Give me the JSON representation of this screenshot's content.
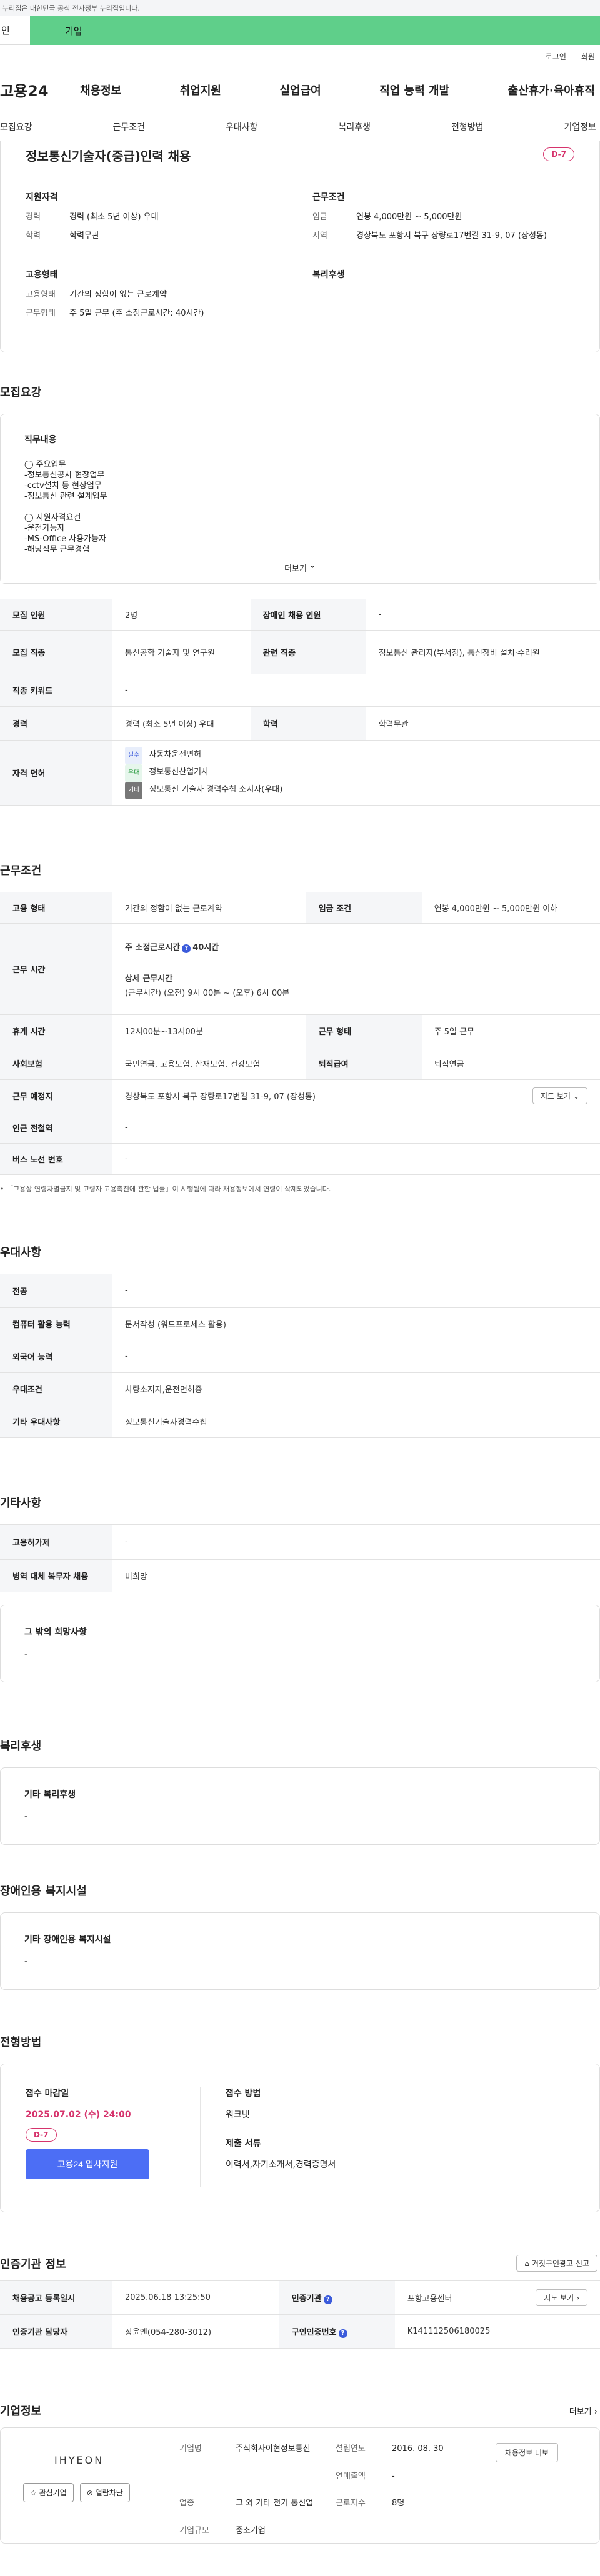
{
  "gov_banner": "누리집은 대한민국 공식 전자정부 누리집입니다.",
  "user_tabs": [
    "인",
    "기업"
  ],
  "util_links": [
    "로그인",
    "회원"
  ],
  "logo": "고용24",
  "gnb": [
    "채용정보",
    "취업지원",
    "실업급여",
    "직업 능력 개발",
    "출산휴가·육아휴직"
  ],
  "subnav": [
    "모집요강",
    "근무조건",
    "우대사항",
    "복리후생",
    "전형방법",
    "기업정보"
  ],
  "summary": {
    "title": "정보통신기술자(중급)인력 채용",
    "dday": "D-7",
    "qual_title": "지원자격",
    "qual": [
      {
        "k": "경력",
        "v": "경력 (최소 5년 이상) 우대"
      },
      {
        "k": "학력",
        "v": "학력무관"
      }
    ],
    "cond_title": "근무조건",
    "cond": [
      {
        "k": "임금",
        "v": "연봉 4,000만원 ~ 5,000만원"
      },
      {
        "k": "지역",
        "v": "경상북도 포항시 북구 장량로17번길 31-9, 07 (장성동)"
      }
    ],
    "emp_title": "고용형태",
    "emp": [
      {
        "k": "고용형태",
        "v": "기간의 정함이 없는 근로계약"
      },
      {
        "k": "근무형태",
        "v": "주 5일 근무 (주 소정근로시간: 40시간)"
      }
    ],
    "welfare_title": "복리후생"
  },
  "recruit": {
    "section_title": "모집요강",
    "duty_title": "직무내용",
    "duty_text": "◯ 주요업무\n-정보통신공사 현장업무\n-cctv설치 등 현장업무\n-정보통신 관련 설계업무\n\n◯ 지원자격요건\n-운전가능자\n-MS-Office 사용가능자\n-해당직무 근무경험",
    "more": "더보기",
    "rows": {
      "count_k": "모집 인원",
      "count_v": "2명",
      "disabled_k": "장애인 채용 인원",
      "disabled_v": "-",
      "job_k": "모집 직종",
      "job_v": "통신공학 기술자 및 연구원",
      "related_k": "관련 직종",
      "related_v": "정보통신 관리자(부서장), 통신장비 설치·수리원",
      "keyword_k": "직종 키워드",
      "keyword_v": "-",
      "career_k": "경력",
      "career_v": "경력 (최소 5년 이상) 우대",
      "edu_k": "학력",
      "edu_v": "학력무관",
      "license_k": "자격 면허",
      "licenses": [
        {
          "tag": "필수",
          "name": "자동차운전면허"
        },
        {
          "tag": "우대",
          "name": "정보통신산업기사"
        },
        {
          "tag": "기타",
          "name": "정보통신 기술자 경력수첩 소지자(우대)"
        }
      ]
    }
  },
  "work": {
    "section_title": "근무조건",
    "type_k": "고용 형태",
    "type_v": "기간의 정함이 없는 근로계약",
    "wage_k": "임금 조건",
    "wage_v": "연봉 4,000만원 ~ 5,000만원 이하",
    "hours_k": "근무 시간",
    "hours_weekly_label": "주 소정근로시간",
    "hours_weekly_value": "40시간",
    "hours_detail_label": "상세 근무시간",
    "hours_detail_value": "(근무시간) (오전) 9시 00분 ~ (오후) 6시 00분",
    "break_k": "휴게 시간",
    "break_v": "12시00분~13시00분",
    "form_k": "근무 형태",
    "form_v": "주 5일 근무",
    "insurance_k": "사회보험",
    "insurance_v": "국민연금, 고용보험, 산재보험, 건강보험",
    "severance_k": "퇴직급여",
    "severance_v": "퇴직연금",
    "place_k": "근무 예정지",
    "place_v": "경상북도 포항시 북구 장량로17번길 31-9, 07 (장성동)",
    "map_btn": "지도 보기",
    "subway_k": "인근 전철역",
    "subway_v": "-",
    "bus_k": "버스 노선 번호",
    "bus_v": "-",
    "note": "「고용상 연령차별금지 및 고령자 고용촉진에 관한 법률」이 시행됨에 따라 채용정보에서 연령이 삭제되었습니다."
  },
  "pref": {
    "section_title": "우대사항",
    "rows": [
      {
        "k": "전공",
        "v": "-"
      },
      {
        "k": "컴퓨터 활용 능력",
        "v": "문서작성 (워드프로세스 활용)"
      },
      {
        "k": "외국어 능력",
        "v": "-"
      },
      {
        "k": "우대조건",
        "v": "차량소지자,운전면허증"
      },
      {
        "k": "기타 우대사항",
        "v": "정보통신기술자경력수첩"
      }
    ]
  },
  "etc": {
    "section_title": "기타사항",
    "rows": [
      {
        "k": "고용허가제",
        "v": "-"
      },
      {
        "k": "병역 대체 복무자 채용",
        "v": "비희망"
      }
    ],
    "wish_title": "그 밖의 희망사항",
    "wish_v": "-"
  },
  "welfare": {
    "section_title": "복리후생",
    "card_title": "기타 복리후생",
    "card_v": "-"
  },
  "disability": {
    "section_title": "장애인용 복지시설",
    "card_title": "기타 장애인용 복지시설",
    "card_v": "-"
  },
  "apply": {
    "section_title": "전형방법",
    "deadline_title": "접수 마감일",
    "deadline": "2025.07.02 (수) 24:00",
    "dday": "D-7",
    "button": "고용24 입사지원",
    "method_title": "접수 방법",
    "method_v": "워크넷",
    "docs_title": "제출 서류",
    "docs_v": "이력서,자기소개서,경력증명서"
  },
  "cert": {
    "section_title": "인증기관 정보",
    "report_btn": "거짓구인광고 신고",
    "reg_k": "채용공고 등록일시",
    "reg_v": "2025.06.18 13:25:50",
    "agency_k": "인증기관",
    "agency_v": "포항고용센터",
    "map_btn": "지도 보기",
    "manager_k": "인증기관 담당자",
    "manager_v": "장윤엔(054-280-3012)",
    "offer_k": "구인인증번호",
    "offer_v": "K141112506180025"
  },
  "company": {
    "section_title": "기업정보",
    "more": "더보기",
    "logo_text": "IHYEON",
    "fav_btn": "관심기업",
    "block_btn": "열람차단",
    "name_k": "기업명",
    "name_v": "주식회사이현정보통신",
    "found_k": "설립연도",
    "found_v": "2016. 08. 30",
    "sales_k": "연매출액",
    "sales_v": "-",
    "industry_k": "업종",
    "industry_v": "그 외 기타 전기 통신업",
    "staff_k": "근로자수",
    "staff_v": "8명",
    "scale_k": "기업규모",
    "scale_v": "중소기업",
    "jobs_btn": "채용정보 더보"
  }
}
